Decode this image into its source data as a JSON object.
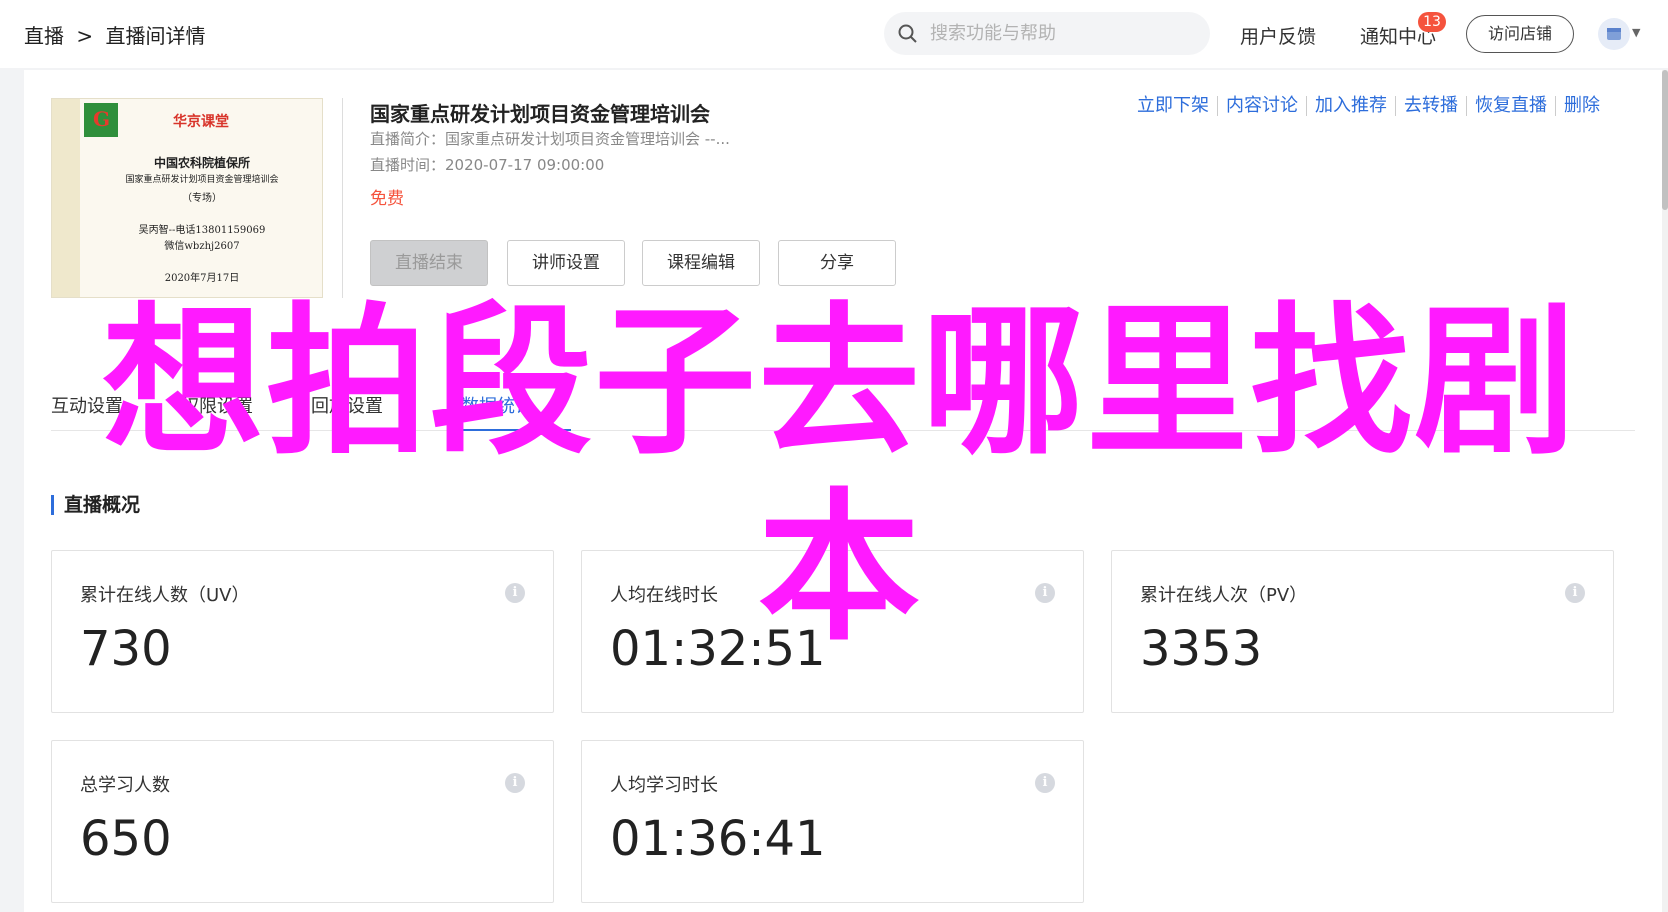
{
  "header": {
    "breadcrumb": [
      "直播",
      ">",
      "直播间详情"
    ],
    "search_placeholder": "搜索功能与帮助",
    "feedback": "用户反馈",
    "notice": "通知中心",
    "notice_count": "13",
    "visit_store": "访问店铺"
  },
  "course": {
    "cover": {
      "brand": "华京课堂",
      "org": "中国农科院植保所",
      "subtitle": "国家重点研发计划项目资金管理培训会",
      "tag": "（专场）",
      "contact": "吴丙智--电话13801159069",
      "wechat": "微信wbzhj2607",
      "date": "2020年7月17日"
    },
    "title": "国家重点研发计划项目资金管理培训会",
    "intro": "直播简介：国家重点研发计划项目资金管理培训会 --...",
    "time": "直播时间：2020-07-17 09:00:00",
    "price": "免费",
    "buttons": [
      "直播结束",
      "讲师设置",
      "课程编辑",
      "分享"
    ],
    "actions": [
      "立即下架",
      "内容讨论",
      "加入推荐",
      "去转播",
      "恢复直播",
      "删除"
    ]
  },
  "tabs": [
    "互动设置",
    "权限设置",
    "回放设置",
    "数据统计"
  ],
  "overview": {
    "title": "直播概况",
    "stats": [
      {
        "label": "累计在线人数（UV）",
        "value": "730"
      },
      {
        "label": "人均在线时长",
        "value": "01:32:51"
      },
      {
        "label": "累计在线人次（PV）",
        "value": "3353"
      },
      {
        "label": "总学习人数",
        "value": "650"
      },
      {
        "label": "人均学习时长",
        "value": "01:36:41"
      }
    ]
  },
  "overlay_text": "想拍段子去哪里找剧本",
  "colors": {
    "accent": "#2d6ddb",
    "price": "#f5533d",
    "overlay": "#ff1aff"
  }
}
